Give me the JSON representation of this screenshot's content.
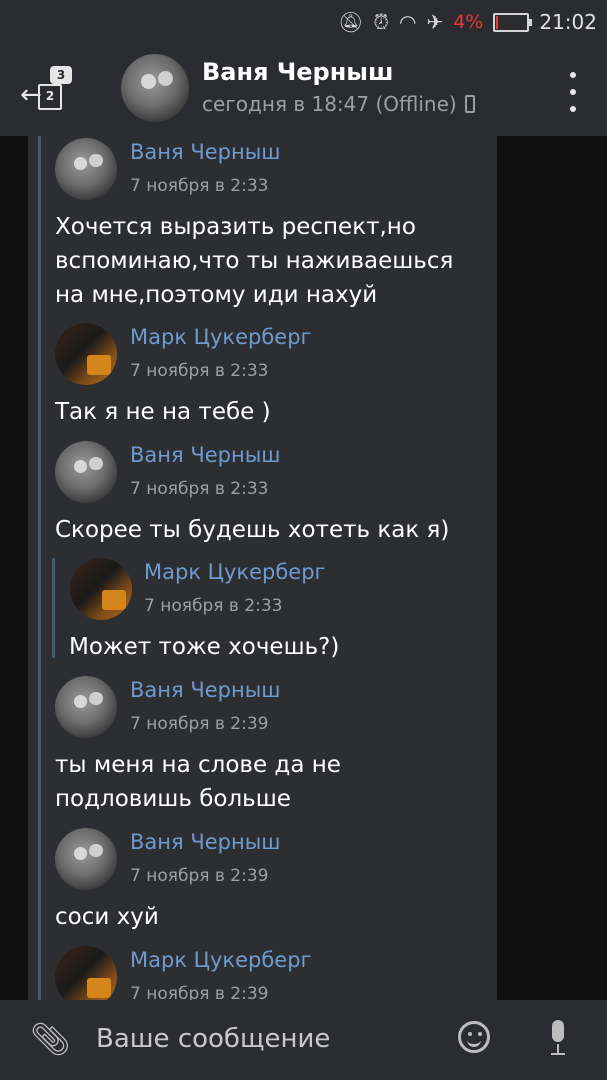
{
  "status_bar": {
    "icons": [
      "mute-icon",
      "alarm-icon",
      "wifi-icon",
      "airplane-icon"
    ],
    "battery_percent": "4%",
    "battery_level": 0.04,
    "time": "21:02"
  },
  "header": {
    "back_badge": "3",
    "back_doc": "2",
    "name": "Ваня Черныш",
    "status": "сегодня в 18:47 (Offline)"
  },
  "messages": [
    {
      "author": "Ваня Черныш",
      "time": "7 ноября в 2:33",
      "text": "Хочется выразить респект,но вспоминаю,что ты наживаешься на мне,поэтому иди нахуй"
    },
    {
      "author": "Марк Цукерберг",
      "time": "7 ноября в 2:33",
      "text": "Так я не на тебе )"
    },
    {
      "author": "Ваня Черныш",
      "time": "7 ноября в 2:33",
      "text": "Скорее ты будешь хотеть как я)"
    },
    {
      "author": "Марк Цукерберг",
      "time": "7 ноября в 2:33",
      "text": "Может тоже хочешь?)"
    },
    {
      "author": "Ваня Черныш",
      "time": "7 ноября в 2:39",
      "text": "ты меня на слове да не подловишь больше"
    },
    {
      "author": "Ваня Черныш",
      "time": "7 ноября в 2:39",
      "text": "соси хуй"
    },
    {
      "author": "Марк Цукерберг",
      "time": "7 ноября в 2:39",
      "text": ""
    }
  ],
  "input": {
    "placeholder": "Ваше сообщение"
  }
}
